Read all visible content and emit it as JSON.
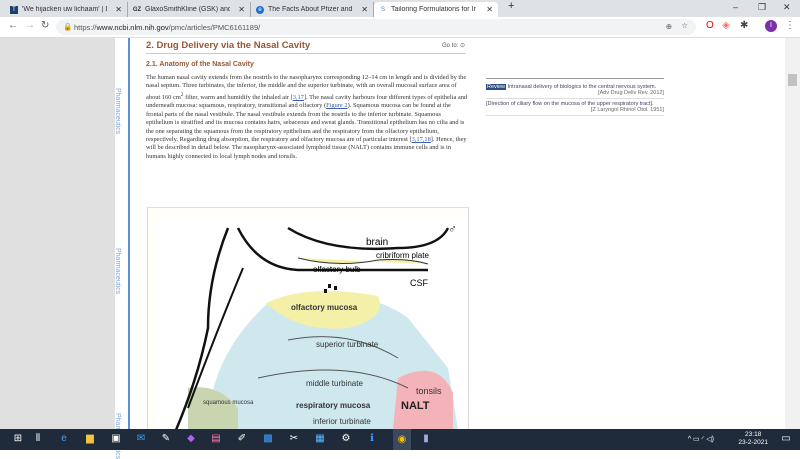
{
  "browser": {
    "tabs": [
      {
        "title": "'We hijacken uw lichaam' | De Tij",
        "favicon": "T"
      },
      {
        "title": "GlaxoSmithKline (GSK) and Alpha",
        "favicon": "GZ"
      },
      {
        "title": "The Facts About Pfizer and BioN",
        "favicon": "e"
      },
      {
        "title": "Tailoring Formulations for Intrana",
        "favicon": "S"
      }
    ],
    "url_prefix": "https://",
    "url_host": "www.ncbi.nlm.nih.gov",
    "url_path": "/pmc/articles/PMC6161189/",
    "profile_initial": "I"
  },
  "article": {
    "side_label": "Pharmaceutics",
    "section_title": "2. Drug Delivery via the Nasal Cavity",
    "goto": "Go to: ⊙",
    "subsection_title": "2.1. Anatomy of the Nasal Cavity",
    "p1": "The human nasal cavity extends from the nostrils to the nasopharynx corresponding 12–14 cm in length and is divided by the nasal septum. Three turbinates, the inferior, the middle and the superior turbinate, with an overall mucosal surface area of about 160 cm",
    "sup": "2",
    "p2": " filter, warm and humidify the inhaled air [",
    "ref1": "3,17",
    "p3": "]. The nasal cavity harbours four different types of epithelia and underneath mucosa: squamous, respiratory, transitional and olfactory (",
    "fig_link": "Figure 2",
    "p4": "). Squamous mucosa can be found at the frontal parts of the nasal vestibule. The nasal vestibule extends from the nostrils to the inferior turbinate. Squamous epithelium is stratified and its mucosa contains hairs, sebaceous and sweat glands. Transitional epithelium has no cilia and is the one separating the squamous from the respiratory epithelium and the respiratory from the olfactory epithelium, respectively. Regarding drug absorption, the respiratory and olfactory mucosa are of particular interest [",
    "ref2": "3,17,18",
    "p5": "]. Hence, they will be described in detail below. The nasopharynx-associated lymphoid tissue (NALT) contains immune cells and is in humans highly connected to local lymph nodes and tonsils."
  },
  "sidebar_refs": [
    {
      "badge": "Review",
      "title": "Intranasal delivery of biologics to the central nervous system.",
      "cite": "[Adv Drug Deliv Rev. 2012]"
    },
    {
      "title": "[Direction of ciliary flow on the mucosa of the upper respiratory tract].",
      "cite": "[Z Laryngol Rhinol Otol. 1951]"
    }
  ],
  "figure": {
    "labels": {
      "brain": "brain",
      "cribriform": "cribriform plate",
      "bulb": "olfactory bulb",
      "csf": "CSF",
      "olfactory": "olfactory mucosa",
      "superior": "superior turbinate",
      "middle": "middle turbinate",
      "respiratory": "respiratory mucosa",
      "tonsils": "tonsils",
      "nalt": "NALT",
      "squamous": "squamous mucosa",
      "inferior": "inferior turbinate"
    }
  },
  "taskbar": {
    "time": "23:18",
    "date": "23-2-2021"
  }
}
